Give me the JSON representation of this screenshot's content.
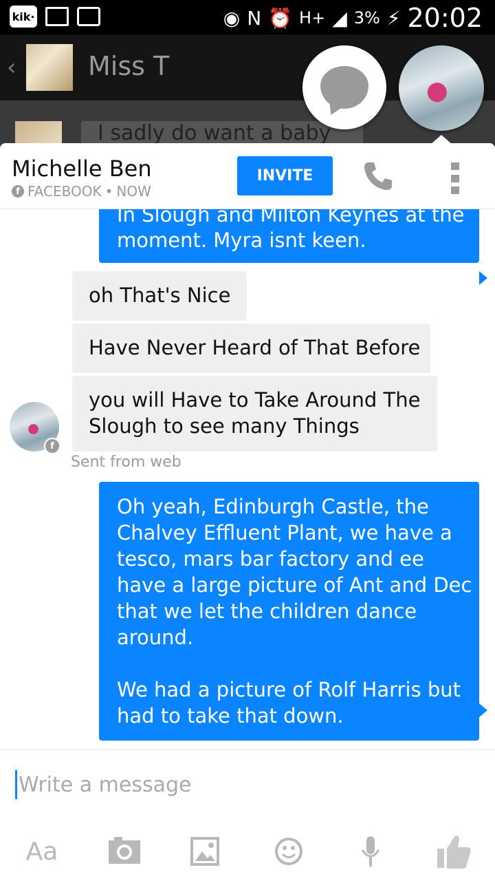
{
  "status_bar": {
    "kik": "kik·",
    "network": "H+",
    "battery": "3%",
    "time": "20:02"
  },
  "background_chat": {
    "back": "‹",
    "title": "Miss T",
    "preview": "I sadly do want a baby"
  },
  "panel": {
    "contact_name": "Michelle Ben",
    "source": "FACEBOOK",
    "separator": "•",
    "time": "NOW",
    "invite_label": "INVITE"
  },
  "messages": [
    {
      "direction": "out",
      "lines": [
        "In Slough and Milton Keynes at the",
        "moment. Myra isnt keen."
      ]
    },
    {
      "direction": "in",
      "lines": [
        "oh That's Nice"
      ]
    },
    {
      "direction": "in",
      "lines": [
        "Have Never Heard of That Before"
      ]
    },
    {
      "direction": "in",
      "lines": [
        "you will Have to Take Around The",
        "Slough to see many Things"
      ]
    },
    {
      "direction": "out",
      "lines": [
        "Oh yeah, Edinburgh Castle, the",
        "Chalvey Effluent Plant, we have a",
        "tesco, mars bar factory and ee",
        "have a large picture of Ant and Dec",
        "that we let the children dance",
        "around.",
        "",
        "We had a picture of Rolf Harris but",
        "had to take that down."
      ]
    }
  ],
  "sent_from": "Sent from web",
  "composer": {
    "placeholder": "Write a message",
    "text_tool": "Aa"
  },
  "colors": {
    "accent": "#0a84ff",
    "incoming_bubble": "#efefef",
    "icon_gray": "#b8b8b8"
  }
}
